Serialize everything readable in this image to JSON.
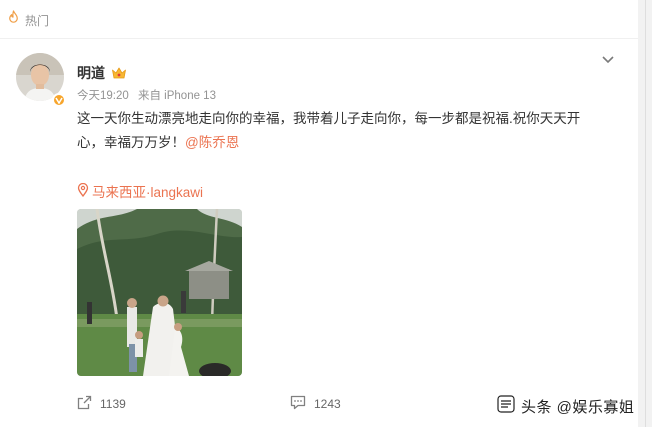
{
  "header": {
    "label": "热门"
  },
  "post": {
    "username": "明道",
    "time": "今天19:20",
    "source": "来自 iPhone 13",
    "text_line1": "这一天你生动漂亮地走向你的幸福，我带着儿子走向你，每一步都是祝福.祝你天天开",
    "text_line2_prefix": "心，幸福万万岁！",
    "mention": "@陈乔恩",
    "location": "马来西亚·langkawi"
  },
  "actions": {
    "share_count": "1139",
    "comment_count": "1243"
  },
  "watermark": {
    "text": "头条 @娱乐寡姐"
  },
  "colors": {
    "accent": "#eb7350",
    "meta": "#939393",
    "text": "#333333",
    "badge": "#f7a52b"
  },
  "icons": {
    "hot": "fire-icon",
    "crown": "crown-badge-icon",
    "verified": "verified-badge-icon",
    "more": "chevron-down-icon",
    "location": "location-pin-icon",
    "share": "share-icon",
    "comment": "comment-icon",
    "watermark": "toutiao-logo-icon"
  }
}
